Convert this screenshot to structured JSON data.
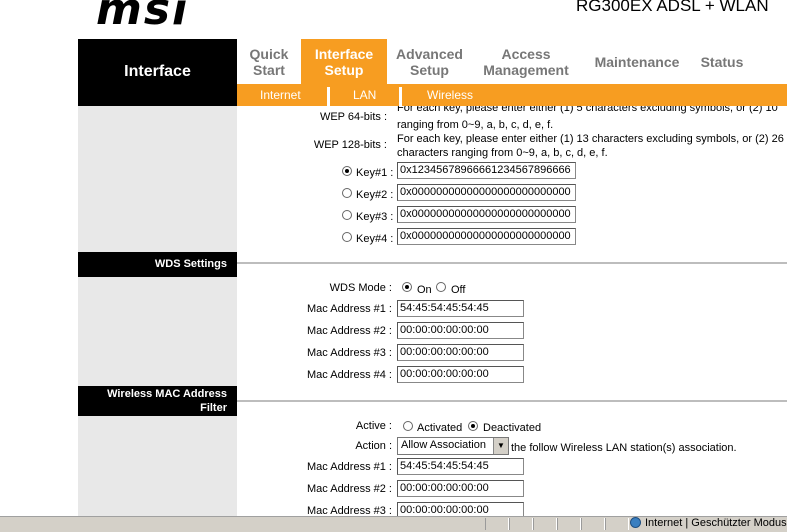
{
  "header": {
    "logo_text": "msi",
    "model": "RG300EX ADSL + WLAN"
  },
  "nav": {
    "section_title": "Interface",
    "items": [
      {
        "line1": "Quick",
        "line2": "Start"
      },
      {
        "line1": "Interface",
        "line2": "Setup"
      },
      {
        "line1": "Advanced",
        "line2": "Setup"
      },
      {
        "line1": "Access",
        "line2": "Management"
      },
      {
        "line1": "Maintenance",
        "line2": ""
      },
      {
        "line1": "Status",
        "line2": ""
      }
    ],
    "subitems": [
      "Internet",
      "LAN",
      "Wireless"
    ]
  },
  "wep": {
    "label_64": "WEP 64-bits :",
    "help_64": "For each key, please enter either (1) 5 characters excluding symbols, or (2) 10",
    "help_64_cont": "ranging from 0~9, a, b, c, d, e, f.",
    "label_128": "WEP 128-bits :",
    "help_128_line1": "For each key, please enter either (1) 13 characters excluding symbols, or (2) 26",
    "help_128_line2": "characters ranging from 0~9, a, b, c, d, e, f.",
    "keys": [
      {
        "label": "Key#1 :",
        "value": "0x12345678966661234567896666"
      },
      {
        "label": "Key#2 :",
        "value": "0x00000000000000000000000000"
      },
      {
        "label": "Key#3 :",
        "value": "0x00000000000000000000000000"
      },
      {
        "label": "Key#4 :",
        "value": "0x00000000000000000000000000"
      }
    ]
  },
  "wds": {
    "section_title": "WDS Settings",
    "mode_label": "WDS Mode :",
    "on_label": "On",
    "off_label": "Off",
    "macs": [
      {
        "label": "Mac Address #1 :",
        "value": "54:45:54:45:54:45"
      },
      {
        "label": "Mac Address #2 :",
        "value": "00:00:00:00:00:00"
      },
      {
        "label": "Mac Address #3 :",
        "value": "00:00:00:00:00:00"
      },
      {
        "label": "Mac Address #4 :",
        "value": "00:00:00:00:00:00"
      }
    ]
  },
  "macfilter": {
    "section_title_line1": "Wireless MAC Address",
    "section_title_line2": "Filter",
    "active_label": "Active :",
    "activated_label": "Activated",
    "deactivated_label": "Deactivated",
    "action_label": "Action :",
    "action_value": "Allow Association",
    "action_suffix": "the follow Wireless LAN station(s) association.",
    "macs": [
      {
        "label": "Mac Address #1 :",
        "value": "54:45:54:45:54:45"
      },
      {
        "label": "Mac Address #2 :",
        "value": "00:00:00:00:00:00"
      },
      {
        "label": "Mac Address #3 :",
        "value": "00:00:00:00:00:00"
      }
    ]
  },
  "statusbar": {
    "zone_text": "Internet | Geschützter Modus"
  },
  "colors": {
    "accent": "#f79d21",
    "nav_inactive": "#777777",
    "section_bg": "#000000",
    "left_col": "#e8e8e8"
  }
}
